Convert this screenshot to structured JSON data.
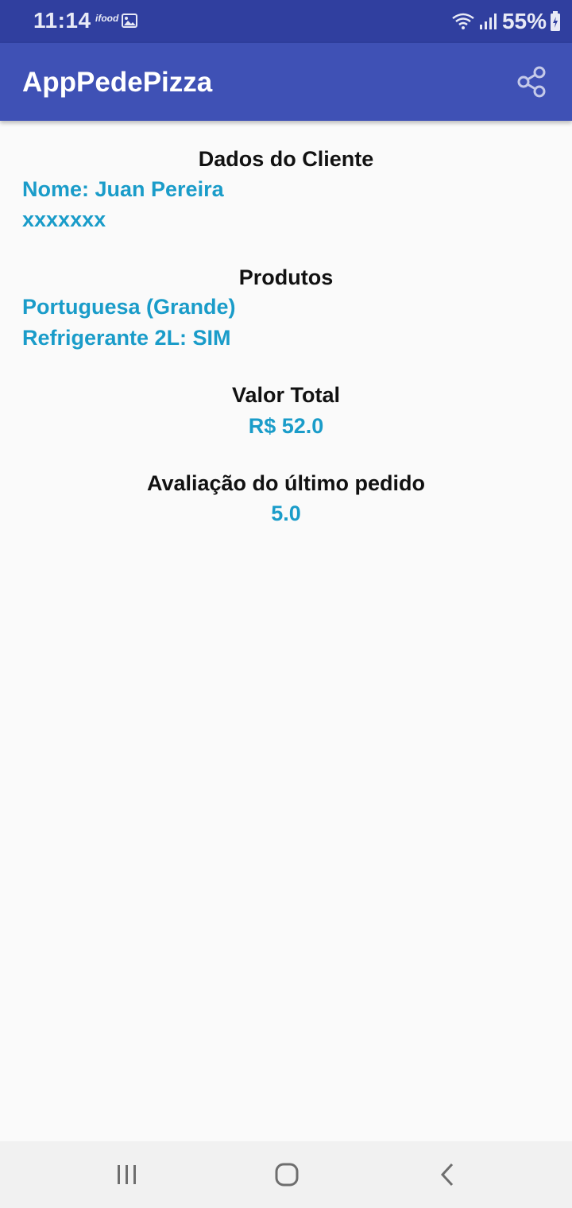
{
  "status_bar": {
    "time": "11:14",
    "notif_app": "ifood",
    "battery": "55%"
  },
  "app_bar": {
    "title": "AppPedePizza",
    "share_icon": "share-icon"
  },
  "customer": {
    "heading": "Dados do Cliente",
    "name": "Nome: Juan Pereira",
    "phone": "xxxxxxx"
  },
  "products": {
    "heading": "Produtos",
    "items": [
      "Portuguesa (Grande)",
      "Refrigerante 2L: SIM"
    ]
  },
  "total": {
    "heading": "Valor Total",
    "value": "R$ 52.0"
  },
  "rating": {
    "heading": "Avaliação do último pedido",
    "value": "5.0"
  },
  "colors": {
    "status_bar": "#303f9f",
    "app_bar": "#3f51b5",
    "accent_text": "#1a9cc9",
    "background": "#fafafa"
  }
}
